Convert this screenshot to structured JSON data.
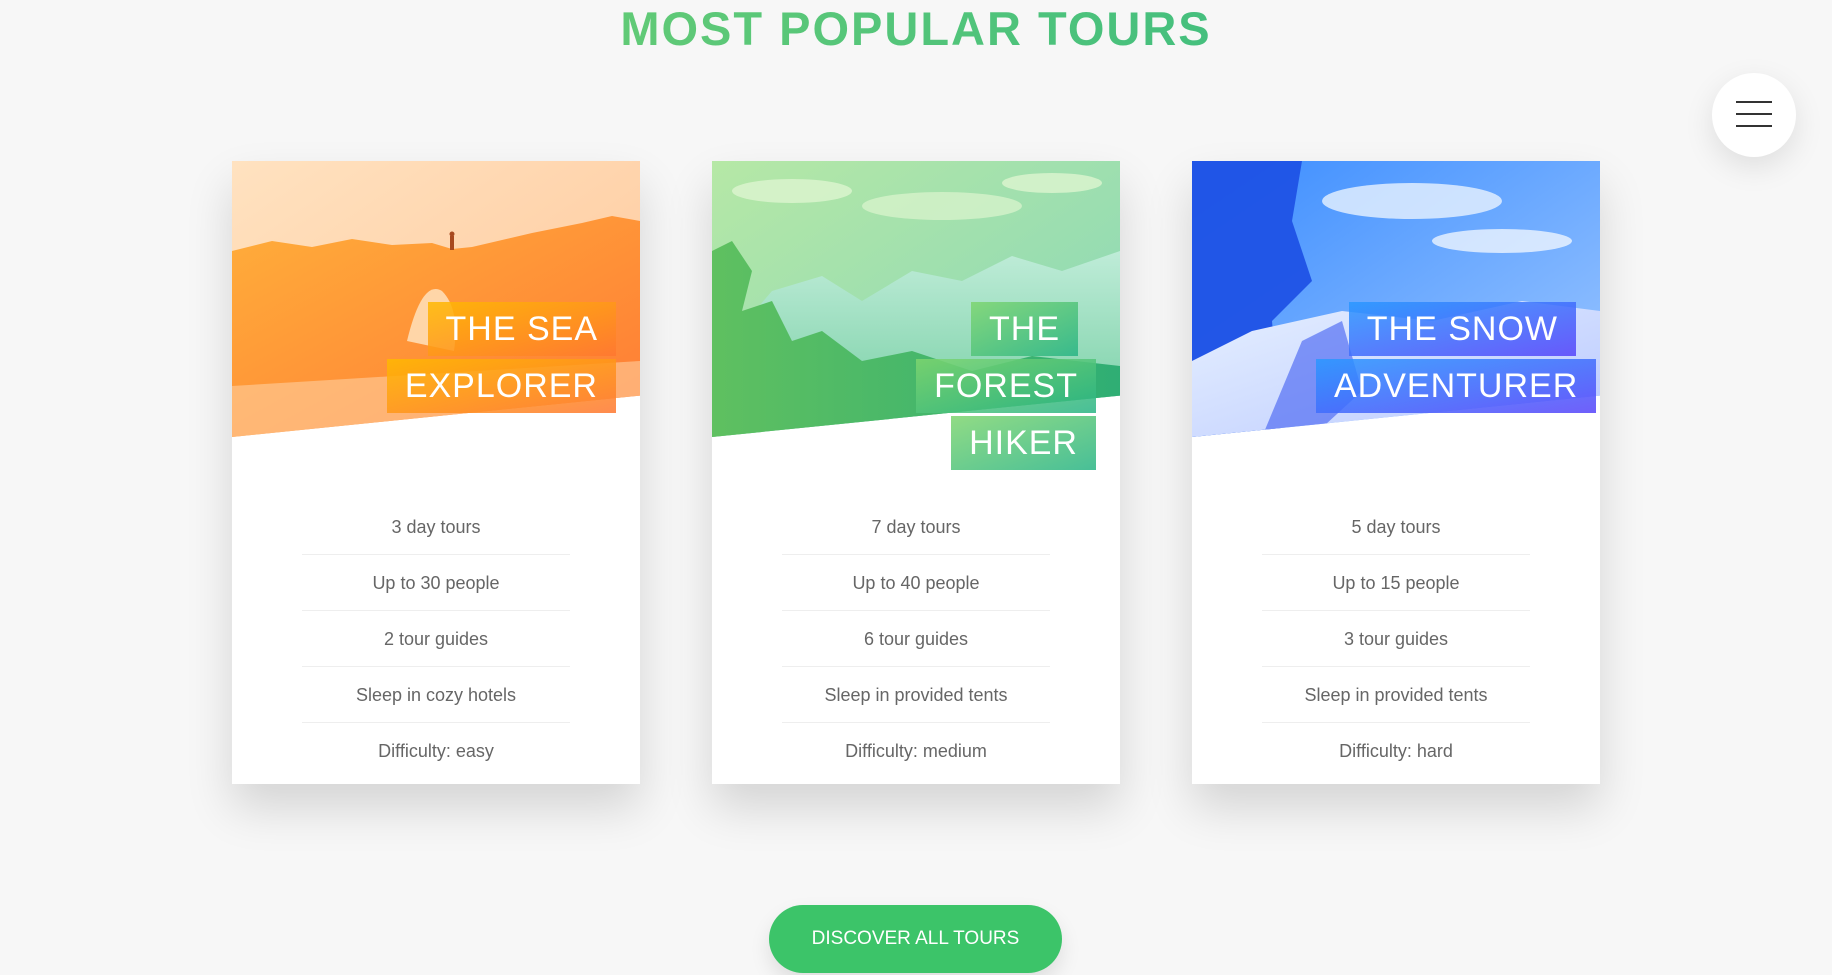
{
  "section": {
    "title": "MOST POPULAR TOURS"
  },
  "navigation": {
    "icon": "hamburger-menu-icon"
  },
  "tours": [
    {
      "heading_line1": "THE SEA",
      "heading_line2": "EXPLORER",
      "accent_colors": [
        "#ffb900",
        "#ff7730"
      ],
      "details": [
        "3 day tours",
        "Up to 30 people",
        "2 tour guides",
        "Sleep in cozy hotels",
        "Difficulty: easy"
      ]
    },
    {
      "heading_line1": "THE FOREST",
      "heading_line2": "HIKER",
      "accent_colors": [
        "#7ed56f",
        "#28b485"
      ],
      "details": [
        "7 day tours",
        "Up to 40 people",
        "6 tour guides",
        "Sleep in provided tents",
        "Difficulty: medium"
      ]
    },
    {
      "heading_line1": "THE SNOW",
      "heading_line2": "ADVENTURER",
      "accent_colors": [
        "#2998ff",
        "#5643fa"
      ],
      "details": [
        "5 day tours",
        "Up to 15 people",
        "3 tour guides",
        "Sleep in provided tents",
        "Difficulty: hard"
      ]
    }
  ],
  "cta": {
    "label": "DISCOVER ALL TOURS",
    "color": "#3cc469"
  }
}
